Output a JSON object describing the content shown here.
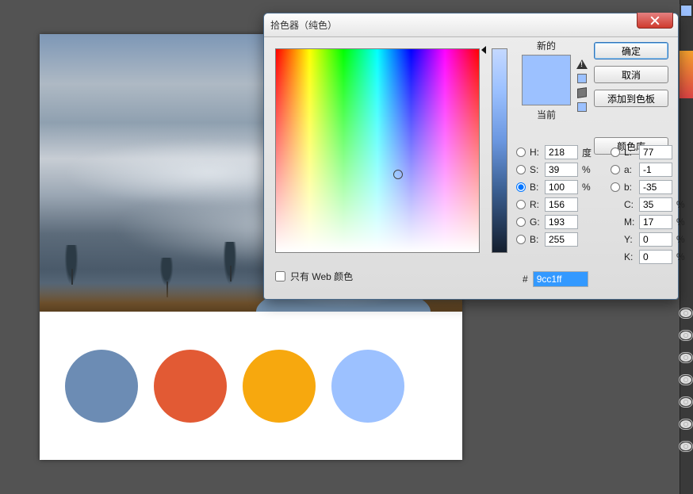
{
  "dialog": {
    "title": "拾色器（纯色）",
    "ok": "确定",
    "cancel": "取消",
    "add_swatch": "添加到色板",
    "color_lib": "颜色库",
    "new_label": "新的",
    "current_label": "当前",
    "web_only": "只有 Web 颜色",
    "hex_prefix": "#",
    "hex_value": "9cc1ff",
    "preview_new_color": "#9cc1ff",
    "preview_cur_color": "#9cc1ff"
  },
  "fields": {
    "H": {
      "label": "H:",
      "value": "218",
      "unit": "度"
    },
    "S": {
      "label": "S:",
      "value": "39",
      "unit": "%"
    },
    "Bv": {
      "label": "B:",
      "value": "100",
      "unit": "%"
    },
    "R": {
      "label": "R:",
      "value": "156",
      "unit": ""
    },
    "G": {
      "label": "G:",
      "value": "193",
      "unit": ""
    },
    "Bc": {
      "label": "B:",
      "value": "255",
      "unit": ""
    },
    "L": {
      "label": "L:",
      "value": "77",
      "unit": ""
    },
    "a": {
      "label": "a:",
      "value": "-1",
      "unit": ""
    },
    "b": {
      "label": "b:",
      "value": "-35",
      "unit": ""
    },
    "C": {
      "label": "C:",
      "value": "35",
      "unit": "%"
    },
    "M": {
      "label": "M:",
      "value": "17",
      "unit": "%"
    },
    "Y": {
      "label": "Y:",
      "value": "0",
      "unit": "%"
    },
    "K": {
      "label": "K:",
      "value": "0",
      "unit": "%"
    }
  },
  "palette": {
    "swatches": [
      "#6c8cb4",
      "#e25a34",
      "#f7a80e",
      "#9cc1ff"
    ]
  }
}
